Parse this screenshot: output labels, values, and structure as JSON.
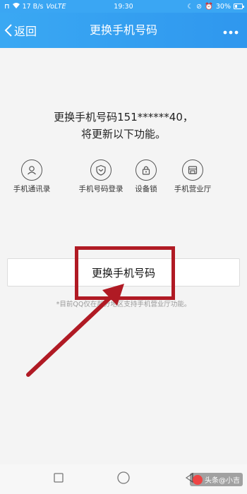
{
  "status_bar": {
    "signal_text": "17 B/s",
    "network": "VoLTE",
    "time": "19:30",
    "battery": "30%",
    "battery_level": 0.3
  },
  "header": {
    "back_label": "返回",
    "title": "更换手机号码"
  },
  "main": {
    "headline_line1": "更换手机号码151******40，",
    "headline_line2": "将更新以下功能。",
    "features": [
      {
        "label": "手机通讯录",
        "icon": "contacts-icon"
      },
      {
        "label": "手机号码登录",
        "icon": "shield-icon"
      },
      {
        "label": "设备锁",
        "icon": "lock-icon"
      },
      {
        "label": "手机营业厅",
        "icon": "store-icon"
      }
    ],
    "change_button_label": "更换手机号码",
    "note": "*目前QQ仅在部分地区支持手机营业厅功能。"
  },
  "watermark": "头条@小吉",
  "colors": {
    "accent": "#3aa6f3",
    "annotation": "#b01a24"
  }
}
